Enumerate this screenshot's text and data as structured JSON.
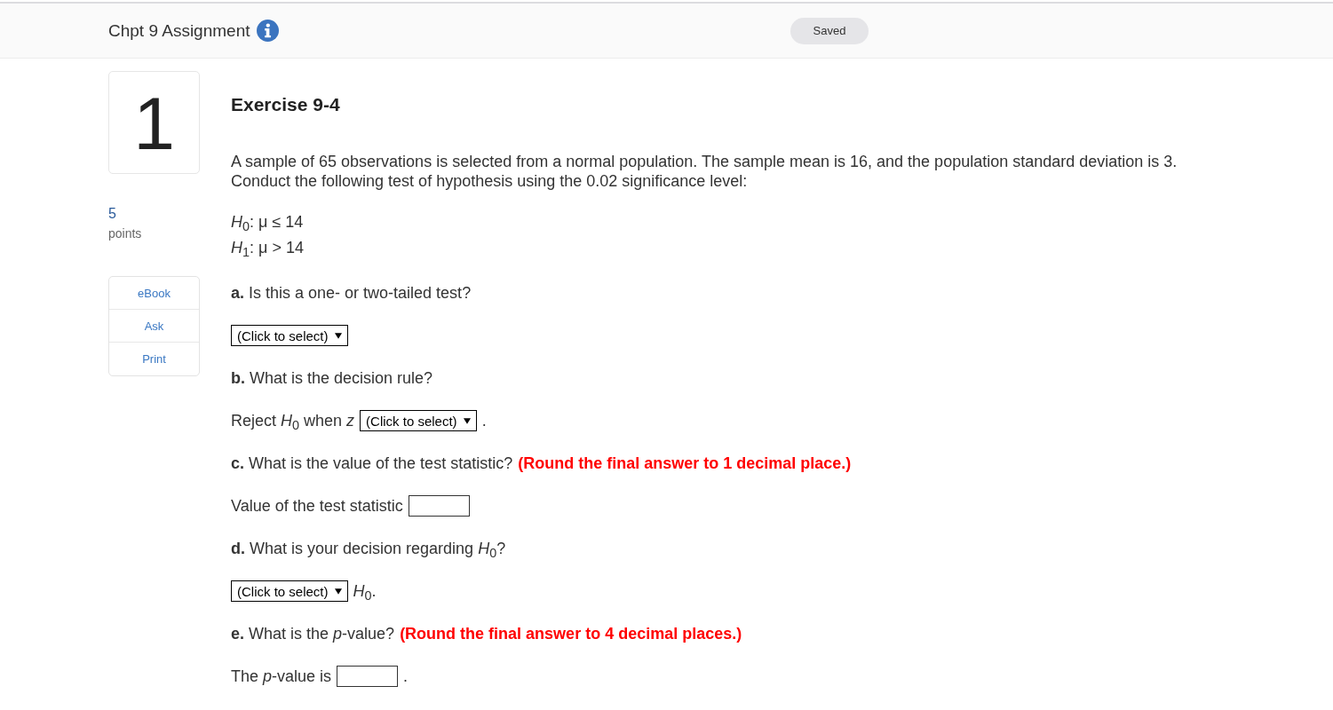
{
  "header": {
    "title": "Chpt 9 Assignment",
    "status": "Saved"
  },
  "question": {
    "number": "1",
    "points": "5",
    "points_label": "points",
    "tools": [
      "eBook",
      "Ask",
      "Print"
    ]
  },
  "exercise": {
    "title": "Exercise 9-4",
    "prompt": [
      "A sample of 65 observations is selected from a normal population. The sample mean is 16, and the population standard deviation is 3.",
      "Conduct the following test of hypothesis using the 0.02 significance level:"
    ],
    "hypotheses": [
      "*H*$_{0}$: μ ≤ 14",
      "*H*$_{1}$: μ > 14"
    ],
    "parts": [
      {
        "question": "**a.** Is this a one- or two-tailed test?",
        "answer": [
          {
            "kind": "select",
            "value": "(Click to select)"
          }
        ]
      },
      {
        "question": "**b.** What is the decision rule?",
        "answer": [
          {
            "kind": "text",
            "text": "Reject *H*$_{0}$ when *z*"
          },
          {
            "kind": "select",
            "value": "(Click to select)"
          },
          {
            "kind": "text",
            "text": "."
          }
        ]
      },
      {
        "question": "**c.** What is the value of the test statistic?",
        "note": "(Round the final answer to 1 decimal place.)",
        "answer": [
          {
            "kind": "text",
            "text": "Value of the test statistic"
          },
          {
            "kind": "input"
          }
        ]
      },
      {
        "question": "**d.** What is your decision regarding *H*$_{0}$?",
        "answer": [
          {
            "kind": "select",
            "value": "(Click to select)"
          },
          {
            "kind": "text",
            "text": "*H*$_{0}$."
          }
        ]
      },
      {
        "question": "**e.** What is the *p*-value?",
        "note": "(Round the final answer to 4 decimal places.)",
        "answer": [
          {
            "kind": "text",
            "text": "The *p*-value is"
          },
          {
            "kind": "input"
          },
          {
            "kind": "text",
            "text": "."
          }
        ]
      }
    ]
  }
}
